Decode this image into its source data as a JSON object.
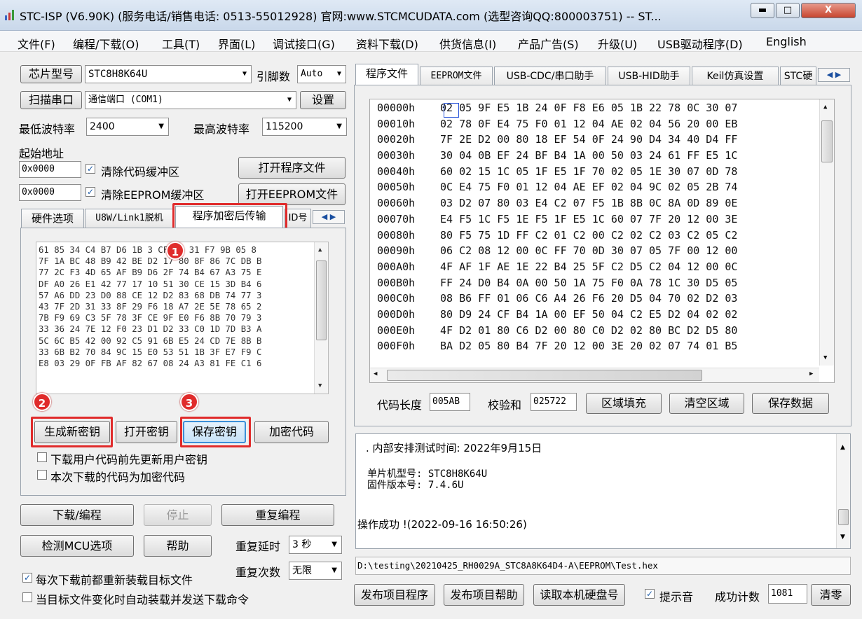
{
  "window": {
    "title": "STC-ISP (V6.90K) (服务电话/销售电话: 0513-55012928) 官网:www.STCMCUDATA.com  (选型咨询QQ:800003751) -- ST...",
    "minimize": "▬",
    "maximize": "□",
    "close": "X"
  },
  "menu": [
    "文件(F)",
    "编程/下载(O)",
    "工具(T)",
    "界面(L)",
    "调试接口(G)",
    "资料下载(D)",
    "供货信息(I)",
    "产品广告(S)",
    "升级(U)",
    "USB驱动程序(D)",
    "English"
  ],
  "left": {
    "chip_button": "芯片型号",
    "chip_value": "STC8H8K64U",
    "pin_label": "引脚数",
    "pin_value": "Auto",
    "scan_button": "扫描串口",
    "port_value": "通信端口 (COM1)",
    "settings_button": "设置",
    "min_baud_label": "最低波特率",
    "min_baud_value": "2400",
    "max_baud_label": "最高波特率",
    "max_baud_value": "115200",
    "start_addr_label": "起始地址",
    "addr1": "0x0000",
    "clear_code_label": "清除代码缓冲区",
    "open_program_button": "打开程序文件",
    "addr2": "0x0000",
    "clear_eeprom_label": "清除EEPROM缓冲区",
    "open_eeprom_button": "打开EEPROM文件",
    "tabs": [
      "硬件选项",
      "U8W/Link1脱机",
      "程序加密后传输",
      "ID号"
    ],
    "key_lines": [
      "61 85 34 C4 B7 D6 1B 3 CF B0 31 F7 9B 05 8",
      "7F 1A BC 48 B9 42 BE D2 17 80 8F 86 7C DB B",
      "77 2C F3 4D 65 AF B9 D6 2F 74 B4 67 A3 75 E",
      "DF A0 26 E1 42 77 17 10 51 30 CE 15 3D B4 6",
      "57 A6 DD 23 D0 88 CE 12 D2 83 68 DB 74 77 3",
      "43 7F 2D 31 33 8F 29 F6 18 A7 2E 5E 78 65 2",
      "7B F9 69 C3 5F 78 3F CE 9F E0 F6 8B 70 79 3",
      "33 36 24 7E 12 F0 23 D1 D2 33 C0 1D 7D B3 A",
      "5C 6C B5 42 00 92 C5 91 6B E5 24 CD 7E 8B B",
      "33 6B B2 70 84 9C 15 E0 53 51 1B 3F E7 F9 C",
      "E8 03 29 0F FB AF 82 67 08 24 A3 81 FE C1 6"
    ],
    "gen_key_button": "生成新密钥",
    "open_key_button": "打开密钥",
    "save_key_button": "保存密钥",
    "encrypt_button": "加密代码",
    "update_key_label": "下载用户代码前先更新用户密钥",
    "encrypted_code_label": "本次下载的代码为加密代码",
    "download_button": "下载/编程",
    "stop_button": "停止",
    "reprogram_button": "重复编程",
    "check_mcu_button": "检测MCU选项",
    "help_button": "帮助",
    "repeat_delay_label": "重复延时",
    "repeat_delay_value": "3 秒",
    "repeat_count_label": "重复次数",
    "repeat_count_value": "无限",
    "reload_label": "每次下载前都重新装载目标文件",
    "auto_download_label": "当目标文件变化时自动装载并发送下载命令",
    "badges": [
      "1",
      "2",
      "3"
    ]
  },
  "right": {
    "tabs": [
      "程序文件",
      "EEPROM文件",
      "USB-CDC/串口助手",
      "USB-HID助手",
      "Keil仿真设置",
      "STC硬"
    ],
    "hex_rows": [
      {
        "addr": "00000h",
        "bytes": "02 05 9F E5 1B 24 0F F8 E6 05 1B 22 78 0C 30 07"
      },
      {
        "addr": "00010h",
        "bytes": "02 78 0F E4 75 F0 01 12 04 AE 02 04 56 20 00 EB"
      },
      {
        "addr": "00020h",
        "bytes": "7F 2E D2 00 80 18 EF 54 0F 24 90 D4 34 40 D4 FF"
      },
      {
        "addr": "00030h",
        "bytes": "30 04 0B EF 24 BF B4 1A 00 50 03 24 61 FF E5 1C"
      },
      {
        "addr": "00040h",
        "bytes": "60 02 15 1C 05 1F E5 1F 70 02 05 1E 30 07 0D 78"
      },
      {
        "addr": "00050h",
        "bytes": "0C E4 75 F0 01 12 04 AE EF 02 04 9C 02 05 2B 74"
      },
      {
        "addr": "00060h",
        "bytes": "03 D2 07 80 03 E4 C2 07 F5 1B 8B 0C 8A 0D 89 0E"
      },
      {
        "addr": "00070h",
        "bytes": "E4 F5 1C F5 1E F5 1F E5 1C 60 07 7F 20 12 00 3E"
      },
      {
        "addr": "00080h",
        "bytes": "80 F5 75 1D FF C2 01 C2 00 C2 02 C2 03 C2 05 C2"
      },
      {
        "addr": "00090h",
        "bytes": "06 C2 08 12 00 0C FF 70 0D 30 07 05 7F 00 12 00"
      },
      {
        "addr": "000A0h",
        "bytes": "4F AF 1F AE 1E 22 B4 25 5F C2 D5 C2 04 12 00 0C"
      },
      {
        "addr": "000B0h",
        "bytes": "FF 24 D0 B4 0A 00 50 1A 75 F0 0A 78 1C 30 D5 05"
      },
      {
        "addr": "000C0h",
        "bytes": "08 B6 FF 01 06 C6 A4 26 F6 20 D5 04 70 02 D2 03"
      },
      {
        "addr": "000D0h",
        "bytes": "80 D9 24 CF B4 1A 00 EF 50 04 C2 E5 D2 04 02 02"
      },
      {
        "addr": "000E0h",
        "bytes": "4F D2 01 80 C6 D2 00 80 C0 D2 02 80 BC D2 D5 80"
      },
      {
        "addr": "000F0h",
        "bytes": "BA D2 05 80 B4 7F 20 12 00 3E 20 02 07 74 01 B5"
      }
    ],
    "code_len_label": "代码长度",
    "code_len_value": "005AB",
    "checksum_label": "校验和",
    "checksum_value": "025722",
    "fill_button": "区域填充",
    "clear_button": "清空区域",
    "save_data_button": "保存数据",
    "log_line1": ". 内部安排测试时间: 2022年9月15日",
    "log_line2": "单片机型号: STC8H8K64U",
    "log_line3": "固件版本号: 7.4.6U",
    "log_line4": "操作成功 !(2022-09-16 16:50:26)",
    "file_path": "D:\\testing\\20210425_RH0029A_STC8A8K64D4-A\\EEPROM\\Test.hex",
    "publish_button": "发布项目程序",
    "publish_help_button": "发布项目帮助",
    "read_disk_button": "读取本机硬盘号",
    "beep_label": "提示音",
    "success_label": "成功计数",
    "success_value": "1081",
    "clear_count_button": "清零"
  },
  "colors": {
    "highlight_red": "#e02b2b",
    "focus_blue": "#3c8fd8"
  }
}
